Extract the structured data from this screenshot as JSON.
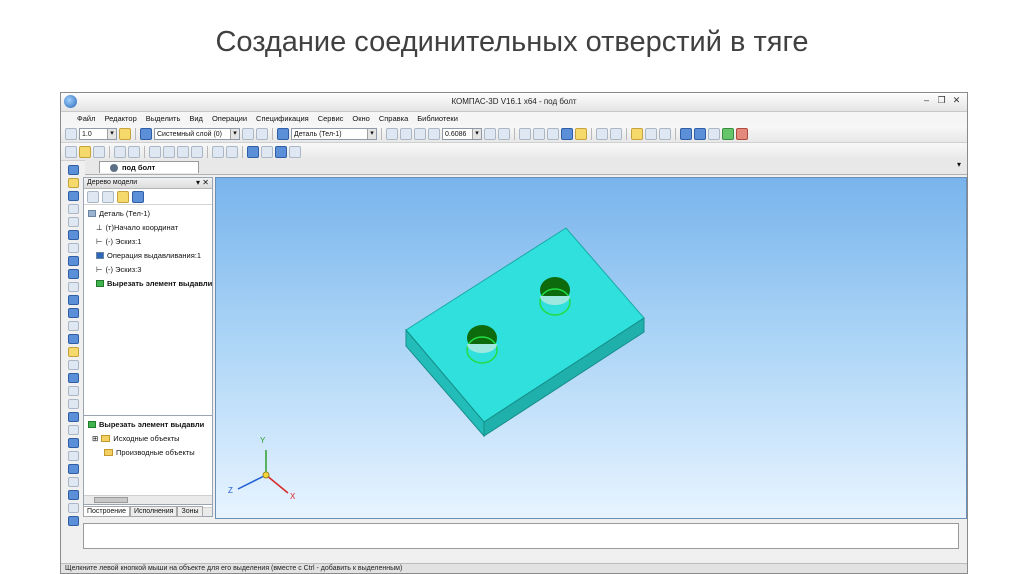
{
  "slide": {
    "title": "Создание соединительных отверстий в тяге"
  },
  "window": {
    "title": "КОМПАС-3D V16.1 x64 - под болт"
  },
  "menu": [
    "Файл",
    "Редактор",
    "Выделить",
    "Вид",
    "Операции",
    "Спецификация",
    "Сервис",
    "Окно",
    "Справка",
    "Библиотеки"
  ],
  "toolbar": {
    "step_value": "1.0",
    "layer": "Системный слой (0)",
    "detail": "Деталь (Тел-1)",
    "zoom": "0.6086"
  },
  "document_tab": {
    "label": "под болт"
  },
  "tree_panel": {
    "title": "Дерево модели",
    "items": [
      "Деталь (Тел-1)",
      "(т)Начало координат",
      "(-) Эскиз:1",
      "Операция выдавливания:1",
      "(-) Эскиз:3",
      "Вырезать элемент выдавли"
    ]
  },
  "detail_panel": {
    "selected": "Вырезать элемент выдавли",
    "items": [
      "Исходные объекты",
      "Производные объекты"
    ]
  },
  "bottom_tabs": [
    "Построение",
    "Исполнения",
    "Зоны"
  ],
  "axes": {
    "x": "X",
    "y": "Y",
    "z": "Z"
  },
  "status": {
    "hint": "Щелкните левой кнопкой мыши на объекте для его выделения (вместе с Ctrl - добавить к выделенным)"
  },
  "colors": {
    "part": "#2fe0dc",
    "hole": "#0d6b0d",
    "background_top": "#78b4ec"
  }
}
